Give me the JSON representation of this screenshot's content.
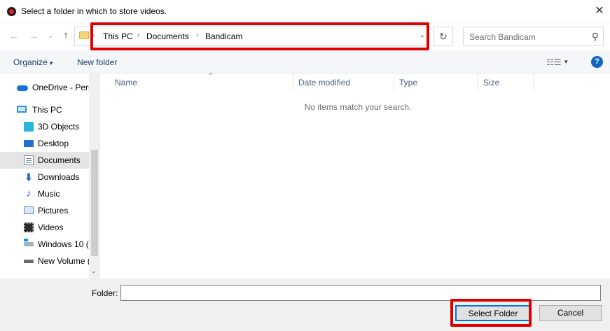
{
  "window": {
    "title": "Select a folder in which to store videos.",
    "close_glyph": "✕"
  },
  "navigation": {
    "back_glyph": "←",
    "forward_glyph": "→",
    "recent_glyph": "⌄",
    "up_glyph": "↑",
    "breadcrumbs": [
      "This PC",
      "Documents",
      "Bandicam"
    ],
    "separator_glyph": "›",
    "dropdown_glyph": "⌄",
    "refresh_glyph": "↻",
    "search_placeholder": "Search Bandicam",
    "search_glyph": "⚲"
  },
  "toolbar": {
    "organize_label": "Organize",
    "organize_caret": "▾",
    "new_folder_label": "New folder",
    "view_glyph": "☷☰",
    "view_caret": "▾",
    "help_glyph": "?"
  },
  "sidebar": {
    "items": [
      {
        "label": "OneDrive - Pers",
        "icon": "onedrive-icon"
      },
      {
        "label": "This PC",
        "icon": "this-pc-icon"
      },
      {
        "label": "3D Objects",
        "icon": "3d-objects-icon"
      },
      {
        "label": "Desktop",
        "icon": "desktop-icon"
      },
      {
        "label": "Documents",
        "icon": "documents-icon",
        "selected": true
      },
      {
        "label": "Downloads",
        "icon": "downloads-icon"
      },
      {
        "label": "Music",
        "icon": "music-icon"
      },
      {
        "label": "Pictures",
        "icon": "pictures-icon"
      },
      {
        "label": "Videos",
        "icon": "videos-icon"
      },
      {
        "label": "Windows 10 (",
        "icon": "windows-drive-icon"
      },
      {
        "label": "New Volume (",
        "icon": "volume-drive-icon"
      }
    ],
    "down_glyph": "⌄",
    "downloads_glyph": "⬇",
    "music_glyph": "♪"
  },
  "file_list": {
    "columns": [
      "Name",
      "Date modified",
      "Type",
      "Size"
    ],
    "sort_glyph": "^",
    "empty_message": "No items match your search."
  },
  "footer": {
    "folder_label": "Folder:",
    "folder_value": "",
    "select_button": "Select Folder",
    "cancel_button": "Cancel"
  },
  "colors": {
    "highlight_red": "#e00000",
    "accent_blue": "#0078d7"
  }
}
